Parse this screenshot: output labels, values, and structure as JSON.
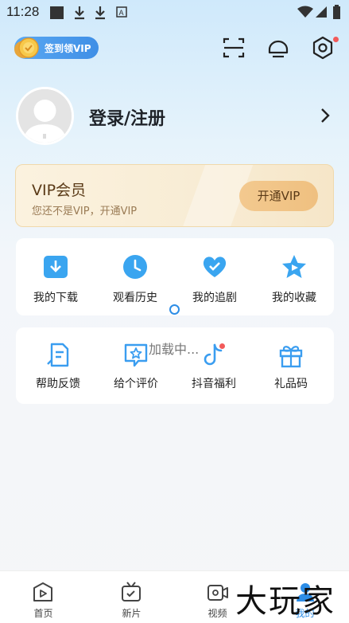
{
  "status_bar": {
    "time": "11:28"
  },
  "header": {
    "vip_pill_label": "签到领VIP",
    "icons": [
      "scan-icon",
      "message-icon",
      "settings-icon"
    ]
  },
  "profile": {
    "login_label": "登录/注册"
  },
  "vip_card": {
    "title": "VIP会员",
    "subtitle": "您还不是VIP，开通VIP",
    "button_label": "开通VIP"
  },
  "grid1": {
    "items": [
      {
        "label": "我的下载",
        "icon": "download-icon"
      },
      {
        "label": "观看历史",
        "icon": "history-clock-icon"
      },
      {
        "label": "我的追剧",
        "icon": "heart-icon"
      },
      {
        "label": "我的收藏",
        "icon": "star-icon"
      }
    ]
  },
  "grid2": {
    "items": [
      {
        "label": "帮助反馈",
        "icon": "feedback-icon"
      },
      {
        "label": "给个评价",
        "icon": "rating-icon"
      },
      {
        "label": "抖音福利",
        "icon": "tiktok-icon"
      },
      {
        "label": "礼品码",
        "icon": "gift-icon"
      }
    ]
  },
  "loading": {
    "text": "加载中..."
  },
  "bottom_nav": {
    "items": [
      {
        "label": "首页",
        "icon": "home-play-icon"
      },
      {
        "label": "新片",
        "icon": "new-film-icon"
      },
      {
        "label": "视频",
        "icon": "video-camera-icon"
      },
      {
        "label": "我的",
        "icon": "profile-icon",
        "active": true
      }
    ]
  },
  "watermark": "大玩家",
  "colors": {
    "accent": "#2d8de6",
    "vip_gold": "#efc080",
    "badge_red": "#f25a5a"
  }
}
